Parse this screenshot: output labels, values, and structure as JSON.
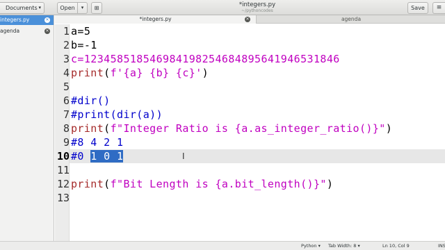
{
  "header": {
    "documents_label": "Documents",
    "open_label": "Open",
    "title": "*integers.py",
    "subtitle": "~/pythoncodes",
    "save_label": "Save"
  },
  "sidebar": {
    "items": [
      {
        "label": "integers.py",
        "active": true
      },
      {
        "label": "agenda",
        "active": false
      }
    ]
  },
  "tabs": [
    {
      "label": "*integers.py",
      "active": true
    },
    {
      "label": "agenda",
      "active": false
    }
  ],
  "editor": {
    "line_numbers": [
      "1",
      "2",
      "3",
      "4",
      "5",
      "6",
      "7",
      "8",
      "9",
      "10",
      "11",
      "12",
      "13"
    ],
    "current_line": 10,
    "lines": [
      [
        {
          "t": "a=5",
          "c": "#000000"
        }
      ],
      [
        {
          "t": "b=-1",
          "c": "#000000"
        }
      ],
      [
        {
          "t": "c=1234585185469841982546848956419465318",
          "c": "#c000c0"
        },
        {
          "t": "46",
          "c": "#c000c0"
        }
      ],
      [
        {
          "t": "print",
          "c": "#a52a2a",
          "b": true
        },
        {
          "t": "(",
          "c": "#000000"
        },
        {
          "t": "f'{a} {b} {c}'",
          "c": "#c000c0"
        },
        {
          "t": ")",
          "c": "#000000"
        }
      ],
      [],
      [
        {
          "t": "#dir()",
          "c": "#0000cc"
        }
      ],
      [
        {
          "t": "#print(dir(a))",
          "c": "#0000cc"
        }
      ],
      [
        {
          "t": "print",
          "c": "#a52a2a",
          "b": true
        },
        {
          "t": "(",
          "c": "#000000"
        },
        {
          "t": "f\"Integer Ratio is {a.as_integer_ratio()}\"",
          "c": "#c000c0"
        },
        {
          "t": ")",
          "c": "#000000"
        }
      ],
      [
        {
          "t": "#8 4 2 1",
          "c": "#0000cc"
        }
      ],
      [
        {
          "t": "#0 ",
          "c": "#0000cc"
        },
        {
          "t": "1 0 1",
          "c": "#ffffff",
          "sel": true
        }
      ],
      [],
      [
        {
          "t": "print",
          "c": "#a52a2a",
          "b": true
        },
        {
          "t": "(",
          "c": "#000000"
        },
        {
          "t": "f\"Bit Length is {a.bit_length()}\"",
          "c": "#c000c0"
        },
        {
          "t": ")",
          "c": "#000000"
        }
      ],
      []
    ]
  },
  "statusbar": {
    "language": "Python",
    "tab_width": "Tab Width: 8",
    "position": "Ln 10, Col 9",
    "mode": "INS"
  },
  "icons": {
    "dropdown": "chevron-down-icon",
    "new_tab": "new-tab-icon",
    "menu": "hamburger-menu-icon",
    "close": "close-icon"
  },
  "colors": {
    "selection": "#2f6cc4",
    "keyword": "#a52a2a",
    "string": "#c000c0",
    "comment": "#0000cc",
    "sidebar_active": "#4a90d9"
  }
}
